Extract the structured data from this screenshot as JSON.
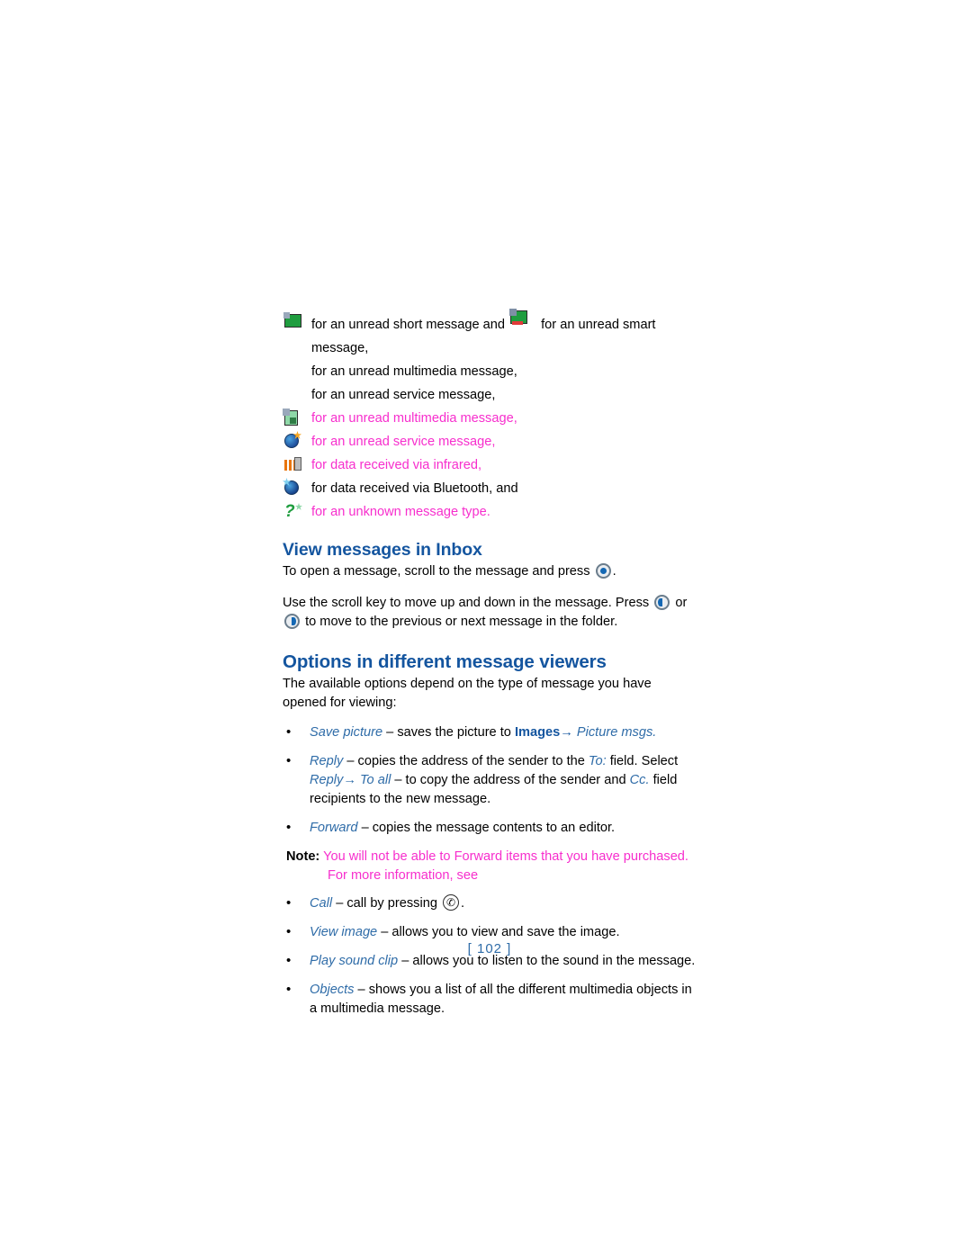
{
  "icon_list": [
    {
      "icon": "unread-short-message-icon",
      "icon2": "unread-smart-message-icon",
      "text_before": "for an unread short message and",
      "text_after": "for an unread smart message,",
      "color": "black"
    },
    {
      "icon": "none",
      "text": "for an unread multimedia message,",
      "color": "black"
    },
    {
      "icon": "none",
      "text": "for an unread service message,",
      "color": "black"
    },
    {
      "icon": "unread-multimedia-message-icon",
      "text": "for an unread multimedia message,",
      "color": "magenta"
    },
    {
      "icon": "unread-service-message-icon",
      "text": "for an unread service message,",
      "color": "magenta"
    },
    {
      "icon": "infrared-data-icon",
      "text": "for data received via infrared,",
      "color": "magenta"
    },
    {
      "icon": "bluetooth-data-icon",
      "text": "for data received via Bluetooth, and",
      "color": "black"
    },
    {
      "icon": "unknown-message-type-icon",
      "text": "for an unknown message type.",
      "color": "magenta"
    }
  ],
  "section_view": {
    "heading": "View messages in Inbox",
    "para1_before": "To open a message, scroll to the message and press",
    "para1_after": ".",
    "para2_before": "Use the scroll key to move up and down in the message. Press",
    "para2_mid": "or",
    "para2_after": "to move to the previous or next message in the folder."
  },
  "section_options": {
    "heading": "Options in different message viewers",
    "intro": "The available options depend on the type of message you have opened for viewing:",
    "bullets": [
      {
        "term": "Save picture",
        "rest_1": " – saves the picture to ",
        "bold_term": "Images",
        "arrow": "→",
        "ital_end": " Picture msgs."
      },
      {
        "term": "Reply",
        "rest_1": " – copies the address of the sender to the ",
        "ital_2": "To:",
        "rest_2": " field. Select ",
        "ital_3": "Reply",
        "arrow": "→",
        "ital_4": "To all",
        "rest_3": " – to copy the address of the sender and ",
        "ital_5": "Cc.",
        "rest_4": " field recipients to the new message."
      },
      {
        "term": "Forward",
        "rest_1": " – copies the message contents to an editor."
      }
    ],
    "note": {
      "label": "Note:",
      "body": "You will not be able to Forward items that you have purchased.",
      "continuation": "For more information, see"
    },
    "bullets_after": [
      {
        "term": "Call",
        "rest_1": " – call by pressing ",
        "icon": "call-key-icon",
        "rest_2": "."
      },
      {
        "term": "View image",
        "rest_1": " – allows you to view and save the image."
      },
      {
        "term": "Play sound clip",
        "rest_1": " – allows you to listen to the sound in the message."
      },
      {
        "term": "Objects",
        "rest_1": " – shows you a list of all the different multimedia objects in a multimedia message."
      }
    ]
  },
  "footer": {
    "page_number": "[ 102 ]"
  },
  "colors": {
    "heading_blue": "#14559f",
    "italic_blue": "#2f6ca8",
    "magenta": "#f72ecd",
    "body_black": "#000000"
  }
}
